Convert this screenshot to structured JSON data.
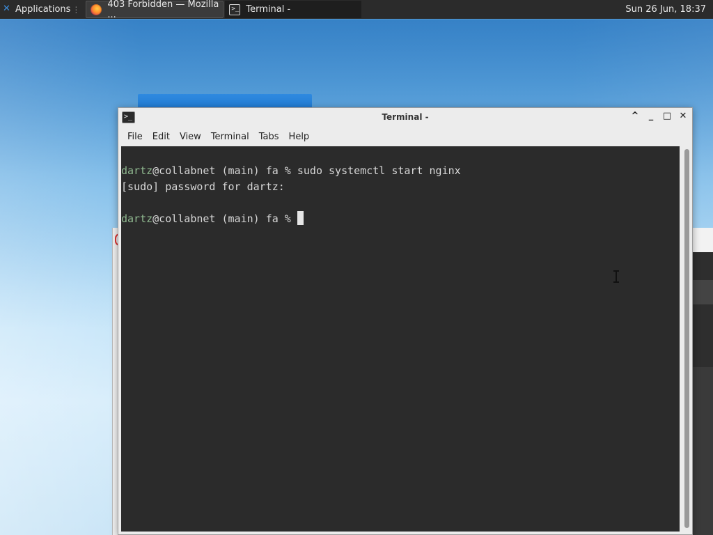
{
  "taskbar": {
    "applications_label": "Applications",
    "separator": "⋮",
    "tasks": [
      {
        "label": "403 Forbidden — Mozilla ...",
        "icon": "firefox-icon"
      },
      {
        "label": "Terminal -",
        "icon": "terminal-icon"
      }
    ],
    "clock": "Sun 26 Jun, 18:37"
  },
  "window": {
    "title": "Terminal -",
    "icon_glyph": ">_",
    "controls": {
      "shade": "^",
      "minimize": "_",
      "maximize": "□",
      "close": "✕"
    },
    "menu": [
      "File",
      "Edit",
      "View",
      "Terminal",
      "Tabs",
      "Help"
    ]
  },
  "terminal": {
    "lines": [
      {
        "user": "dartz",
        "rest": "@collabnet (main) fa % sudo systemctl start nginx"
      },
      {
        "text": "[sudo] password for dartz:"
      },
      {
        "text": ""
      },
      {
        "user": "dartz",
        "rest": "@collabnet (main) fa % "
      }
    ]
  },
  "colors": {
    "terminal_bg": "#2b2b2b",
    "terminal_fg": "#d8d8d8",
    "prompt_user": "#8fb88f",
    "taskbar_bg": "#2b2b2b"
  }
}
